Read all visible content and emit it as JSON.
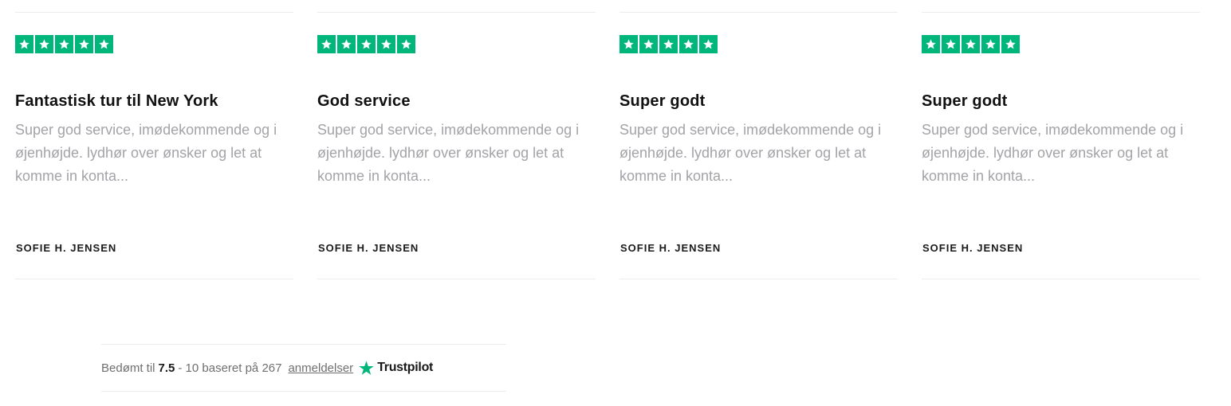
{
  "colors": {
    "star_green": "#00b67a",
    "title": "#111111",
    "body_text": "#a3a3a8",
    "divider": "#ececec"
  },
  "reviews": [
    {
      "rating": 5,
      "title": "Fantastisk tur til New York",
      "text": "Super god service, imødekommende og i øjenhøjde. lydhør over ønsker og let at komme in konta...",
      "author": "SOFIE H. JENSEN"
    },
    {
      "rating": 5,
      "title": "God service",
      "text": "Super god service, imødekommende og i øjenhøjde. lydhør over ønsker og let at komme in konta...",
      "author": "SOFIE H. JENSEN"
    },
    {
      "rating": 5,
      "title": "Super godt",
      "text": "Super god service, imødekommende og i øjenhøjde. lydhør over ønsker og let at komme in konta...",
      "author": "SOFIE H. JENSEN"
    },
    {
      "rating": 5,
      "title": "Super godt",
      "text": "Super god service, imødekommende og i øjenhøjde. lydhør over ønsker og let at komme in konta...",
      "author": "SOFIE H. JENSEN"
    }
  ],
  "summary": {
    "prefix": "Bedømt til",
    "score": "7.5",
    "middle": "- 10 baseret på 267",
    "link_label": "anmeldelser",
    "brand": "Trustpilot",
    "brand_icon": "trustpilot-star-icon"
  }
}
